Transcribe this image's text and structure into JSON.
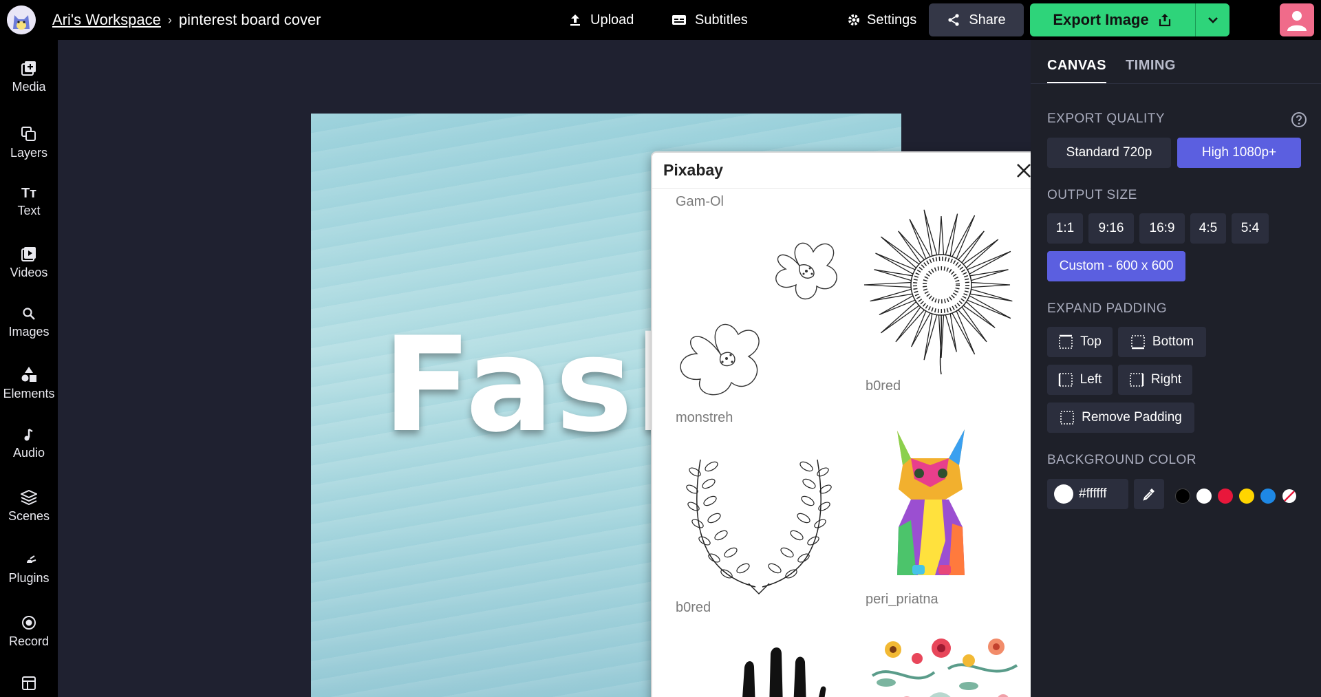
{
  "header": {
    "workspace": "Ari's Workspace",
    "project": "pinterest board cover",
    "upload": "Upload",
    "subtitles": "Subtitles",
    "settings": "Settings",
    "share": "Share",
    "export": "Export Image"
  },
  "sidebar": {
    "items": [
      {
        "label": "Media"
      },
      {
        "label": "Layers"
      },
      {
        "label": "Text"
      },
      {
        "label": "Videos"
      },
      {
        "label": "Images"
      },
      {
        "label": "Elements"
      },
      {
        "label": "Audio"
      },
      {
        "label": "Scenes"
      },
      {
        "label": "Plugins"
      },
      {
        "label": "Record"
      }
    ]
  },
  "canvas": {
    "text": "Fash"
  },
  "pixabay": {
    "title": "Pixabay",
    "authors": [
      "Gam-Ol",
      "monstreh",
      "b0red",
      "b0red",
      "peri_priatna"
    ]
  },
  "panel": {
    "tabs": [
      "CANVAS",
      "TIMING"
    ],
    "export_quality_title": "EXPORT QUALITY",
    "quality_options": [
      "Standard 720p",
      "High 1080p+"
    ],
    "output_size_title": "OUTPUT SIZE",
    "size_options": [
      "1:1",
      "9:16",
      "16:9",
      "4:5",
      "5:4"
    ],
    "custom_size": "Custom - 600 x 600",
    "padding_title": "EXPAND PADDING",
    "padding_options": [
      "Top",
      "Bottom",
      "Left",
      "Right",
      "Remove Padding"
    ],
    "bg_title": "BACKGROUND COLOR",
    "bg_value": "#ffffff",
    "swatches": [
      "#000000",
      "#ffffff",
      "#e8173b",
      "#ffd500",
      "#1e88e5",
      "none"
    ]
  },
  "colors": {
    "accent": "#5b5fe0",
    "export_green": "#2ed47a"
  }
}
